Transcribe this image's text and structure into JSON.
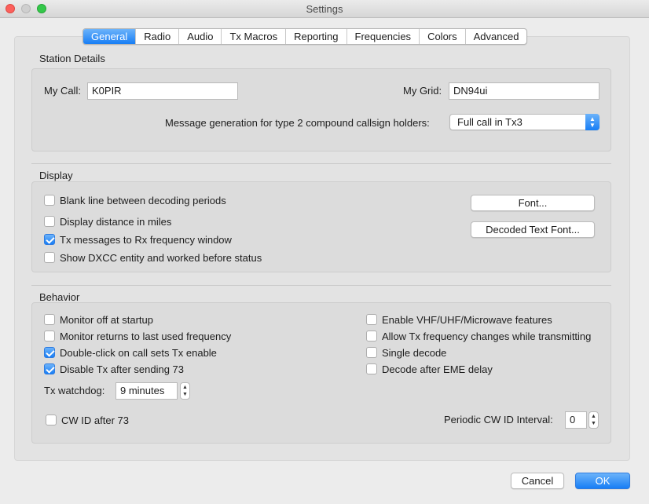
{
  "window": {
    "title": "Settings"
  },
  "tabs": [
    "General",
    "Radio",
    "Audio",
    "Tx Macros",
    "Reporting",
    "Frequencies",
    "Colors",
    "Advanced"
  ],
  "active_tab": "General",
  "station": {
    "title": "Station Details",
    "my_call_label": "My Call:",
    "my_call_value": "K0PIR",
    "my_grid_label": "My Grid:",
    "my_grid_value": "DN94ui",
    "msg_gen_label": "Message generation for type 2 compound callsign holders:",
    "msg_gen_value": "Full call in Tx3"
  },
  "display": {
    "title": "Display",
    "opt_blank_line": "Blank line between decoding periods",
    "opt_distance_miles": "Display distance in miles",
    "opt_tx_to_rx": "Tx messages to Rx frequency window",
    "opt_dxcc": "Show DXCC entity and worked before status",
    "checked": {
      "blank_line": false,
      "distance_miles": false,
      "tx_to_rx": true,
      "dxcc": false
    },
    "font_button": "Font...",
    "decoded_font_button": "Decoded Text Font..."
  },
  "behavior": {
    "title": "Behavior",
    "left": {
      "monitor_off": "Monitor off at startup",
      "monitor_returns": "Monitor returns to last used frequency",
      "double_click": "Double-click on call sets Tx enable",
      "disable_tx": "Disable Tx after sending 73"
    },
    "right": {
      "vhf": "Enable VHF/UHF/Microwave features",
      "allow_tx_freq": "Allow Tx frequency changes while transmitting",
      "single_decode": "Single decode",
      "decode_eme": "Decode after EME delay"
    },
    "checked": {
      "monitor_off": false,
      "monitor_returns": false,
      "double_click": true,
      "disable_tx": true,
      "vhf": false,
      "allow_tx_freq": false,
      "single_decode": false,
      "decode_eme": false,
      "cw_id": false
    },
    "watchdog_label": "Tx watchdog:",
    "watchdog_value": "9 minutes",
    "cw_id_label": "CW ID after 73",
    "periodic_label": "Periodic CW ID Interval:",
    "periodic_value": "0"
  },
  "footer": {
    "cancel": "Cancel",
    "ok": "OK"
  },
  "colors": {
    "accent": "#187ef5",
    "close": "#fc605c",
    "maximize": "#34c84a"
  },
  "icons": {
    "spinner": "up-down-arrows-icon",
    "select": "chevron-updown-icon",
    "check": "checkmark-icon"
  }
}
